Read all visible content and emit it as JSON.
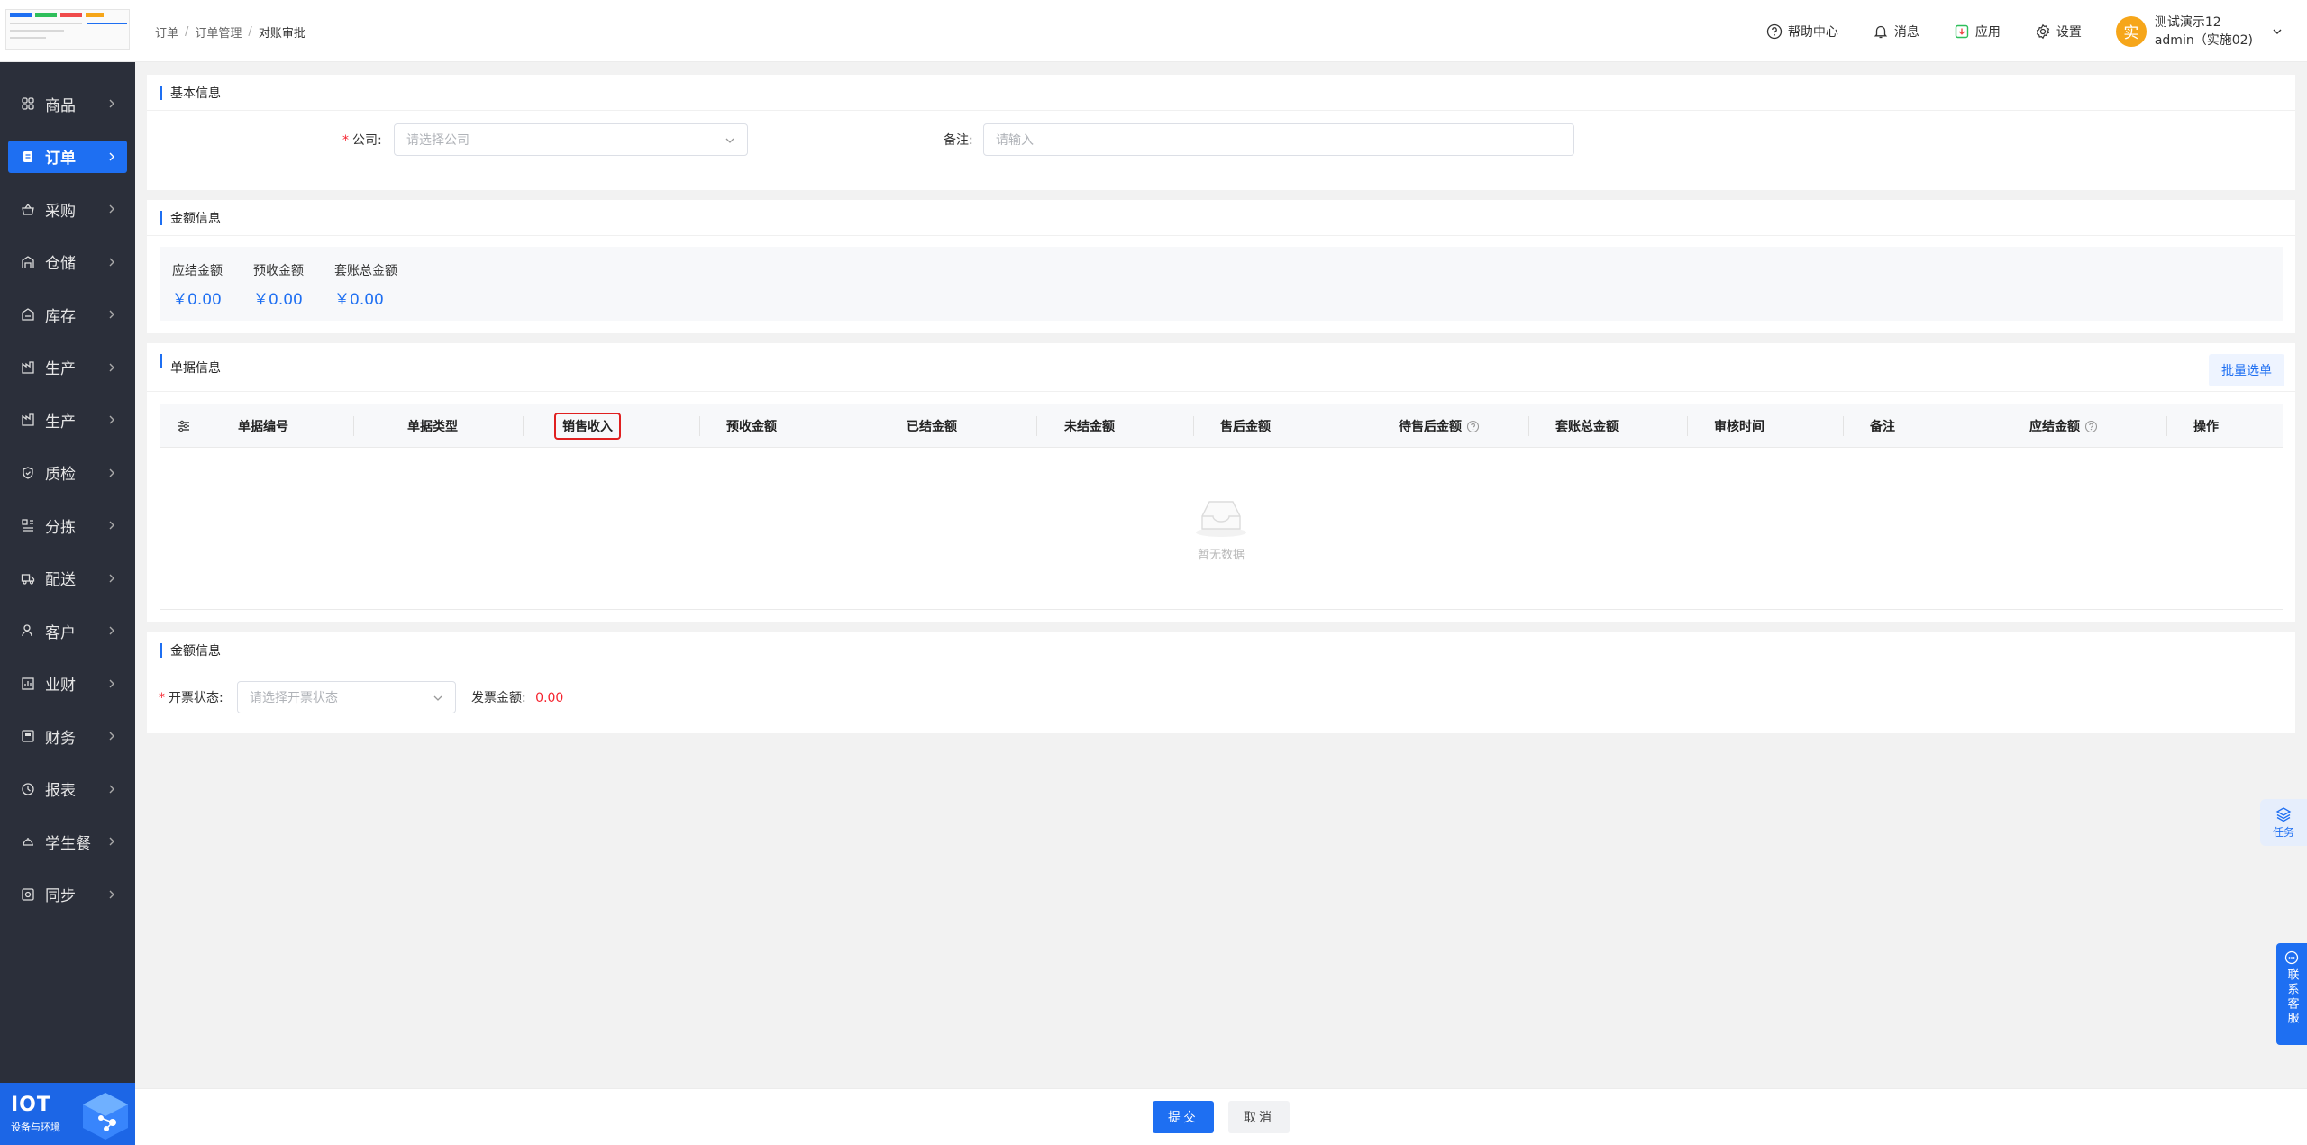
{
  "sidebar": {
    "items": [
      {
        "label": "商品",
        "icon": "grid-icon",
        "active": false
      },
      {
        "label": "订单",
        "icon": "order-icon",
        "active": true
      },
      {
        "label": "采购",
        "icon": "basket-icon",
        "active": false
      },
      {
        "label": "仓储",
        "icon": "warehouse-icon",
        "active": false
      },
      {
        "label": "库存",
        "icon": "stock-icon",
        "active": false
      },
      {
        "label": "生产",
        "icon": "factory-icon",
        "active": false
      },
      {
        "label": "生产",
        "icon": "factory-icon",
        "active": false
      },
      {
        "label": "质检",
        "icon": "shield-icon",
        "active": false
      },
      {
        "label": "分拣",
        "icon": "sort-icon",
        "active": false
      },
      {
        "label": "配送",
        "icon": "truck-icon",
        "active": false
      },
      {
        "label": "客户",
        "icon": "users-icon",
        "active": false
      },
      {
        "label": "业财",
        "icon": "chart-icon",
        "active": false
      },
      {
        "label": "财务",
        "icon": "ledger-icon",
        "active": false
      },
      {
        "label": "报表",
        "icon": "clock-icon",
        "active": false
      },
      {
        "label": "学生餐",
        "icon": "meal-icon",
        "active": false
      },
      {
        "label": "同步",
        "icon": "sync-icon",
        "active": false
      }
    ],
    "iot_title": "IOT",
    "iot_subtitle": "设备与环境"
  },
  "header": {
    "breadcrumb": [
      "订单",
      "订单管理",
      "对账审批"
    ],
    "help": "帮助中心",
    "messages": "消息",
    "apps": "应用",
    "settings": "设置",
    "avatar_char": "实",
    "user_name": "测试演示12",
    "user_account": "admin（实施02)"
  },
  "basic": {
    "title": "基本信息",
    "company_label": "公司:",
    "company_placeholder": "请选择公司",
    "remark_label": "备注:",
    "remark_placeholder": "请输入"
  },
  "amount": {
    "title": "金额信息",
    "items": [
      {
        "label": "应结金额",
        "value": "￥0.00"
      },
      {
        "label": "预收金额",
        "value": "￥0.00"
      },
      {
        "label": "套账总金额",
        "value": "￥0.00"
      }
    ]
  },
  "docs": {
    "title": "单据信息",
    "batch_button": "批量选单",
    "columns": [
      "单据编号",
      "单据类型",
      "销售收入",
      "预收金额",
      "已结金额",
      "未结金额",
      "售后金额",
      "待售后金额",
      "套账总金额",
      "审核时间",
      "备注",
      "应结金额",
      "操作"
    ],
    "empty_text": "暂无数据"
  },
  "invoice": {
    "title": "金额信息",
    "status_label": "开票状态:",
    "status_placeholder": "请选择开票状态",
    "amount_label": "发票金额:",
    "amount_value": "0.00"
  },
  "footer": {
    "submit": "提交",
    "cancel": "取消"
  },
  "floats": {
    "task": "任务",
    "contact": "联系客服"
  },
  "colors": {
    "primary": "#1e6ff2",
    "sidebar_bg": "#2b2f3a",
    "danger": "#f5222d",
    "avatar": "#f6a61a"
  }
}
